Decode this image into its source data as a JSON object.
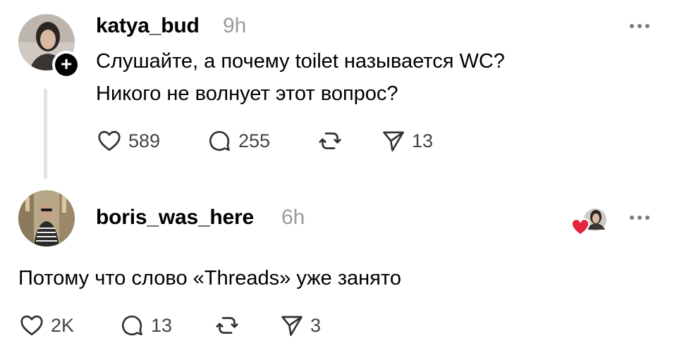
{
  "posts": [
    {
      "username": "katya_bud",
      "time": "9h",
      "text_lines": [
        "Слушайте, а почему toilet называется WC?",
        "Никого не волнует этот вопрос?"
      ],
      "actions": {
        "likes": "589",
        "replies": "255",
        "reposts": "",
        "shares": "13"
      }
    },
    {
      "username": "boris_was_here",
      "time": "6h",
      "text": "Потому что слово «Threads» уже занято",
      "actions": {
        "likes": "2K",
        "replies": "13",
        "reposts": "",
        "shares": "3"
      }
    }
  ],
  "icons": {
    "more": "more-horizontal-icon",
    "like": "heart-outline-icon",
    "reply": "speech-bubble-icon",
    "repost": "repost-icon",
    "share": "send-icon",
    "follow": "plus-icon",
    "liked_by": "red-heart-icon"
  },
  "colors": {
    "text": "#000000",
    "secondary_text": "#9a9a9a",
    "icon": "#444444",
    "heart": "#e8233e",
    "thread_line": "#e3e3e3"
  }
}
